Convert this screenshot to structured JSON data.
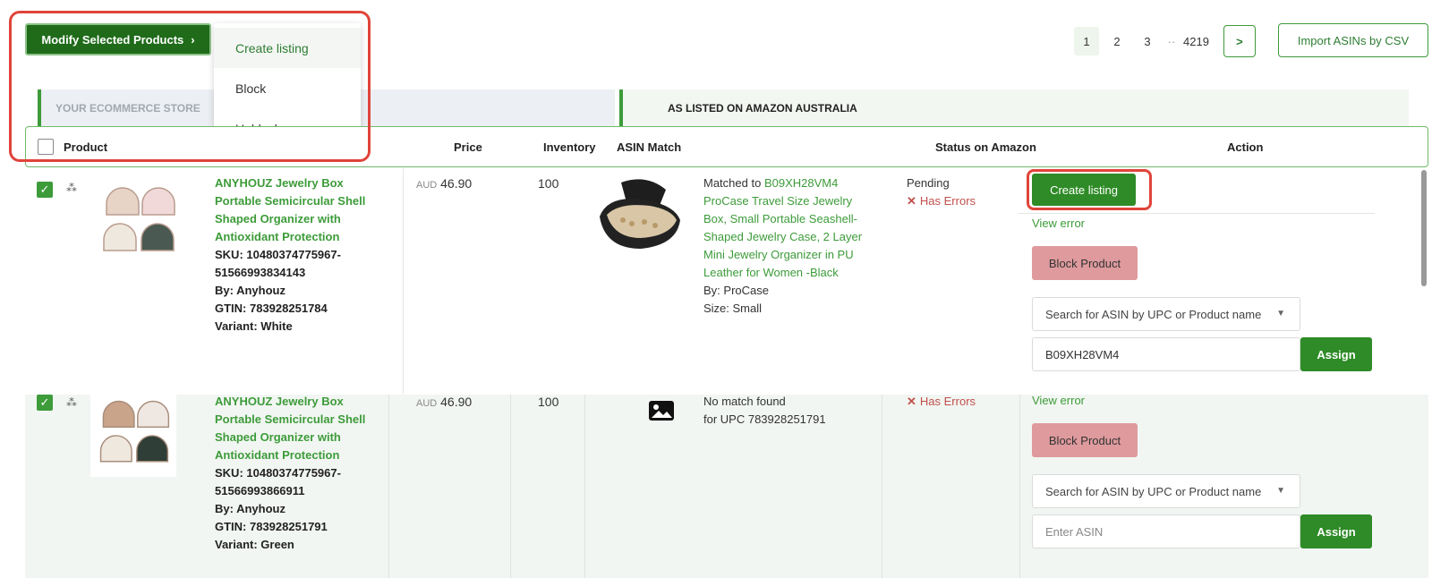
{
  "toolbar": {
    "modify_label": "Modify Selected Products",
    "modify_chevron": "›",
    "dropdown": [
      {
        "label": "Create listing"
      },
      {
        "label": "Block"
      },
      {
        "label": "Unblock"
      }
    ],
    "pages": [
      "1",
      "2",
      "3",
      "··",
      "4219"
    ],
    "next_glyph": ">",
    "import_label": "Import ASINs by CSV"
  },
  "sections": {
    "left": "YOUR ECOMMERCE STORE",
    "right": "AS LISTED ON AMAZON AUSTRALIA"
  },
  "columns": {
    "product": "Product",
    "price": "Price",
    "inventory": "Inventory",
    "asin_match": "ASIN Match",
    "status": "Status on Amazon",
    "action": "Action"
  },
  "rows": [
    {
      "checked": true,
      "name": "ANYHOUZ Jewelry Box Portable Semicircular Shell Shaped Organizer with Antioxidant Protection",
      "sku": "SKU: 10480374775967-51566993834143",
      "by": "By: Anyhouz",
      "gtin": "GTIN: 783928251784",
      "variant": "Variant: White",
      "currency": "AUD",
      "price": "46.90",
      "inventory": "100",
      "match_prefix": "Matched to ",
      "match_asin": "B09XH28VM4",
      "match_title": "ProCase Travel Size Jewelry Box, Small Portable Seashell-Shaped Jewelry Case, 2 Layer Mini Jewelry Organizer in PU Leather for Women -Black",
      "match_by": "By: ProCase",
      "match_size": "Size: Small",
      "status": "Pending",
      "error": "Has Errors",
      "create_label": "Create listing",
      "view_error": "View error",
      "block_label": "Block Product",
      "search_placeholder": "Search for ASIN by UPC or Product name",
      "asin_value": "B09XH28VM4",
      "assign_label": "Assign"
    },
    {
      "checked": true,
      "name": "ANYHOUZ Jewelry Box Portable Semicircular Shell Shaped Organizer with Antioxidant Protection",
      "sku": "SKU: 10480374775967-51566993866911",
      "by": "By: Anyhouz",
      "gtin": "GTIN: 783928251791",
      "variant": "Variant: Green",
      "currency": "AUD",
      "price": "46.90",
      "inventory": "100",
      "nomatch": "No match found",
      "nomatch_upc": "for UPC 783928251791",
      "error": "Has Errors",
      "view_error": "View error",
      "block_label": "Block Product",
      "search_placeholder": "Search for ASIN by UPC or Product name",
      "asin_placeholder": "Enter ASIN",
      "assign_label": "Assign"
    }
  ],
  "icons": {
    "error": "✕",
    "caret": "▼",
    "check": "✓",
    "drag": "⁂"
  },
  "colors": {
    "brand_green": "#2e8b27",
    "dark_green": "#1f6b1a",
    "error_red": "#c0504d",
    "block_pink": "#de9a9d",
    "highlight_red": "#e0443a"
  }
}
